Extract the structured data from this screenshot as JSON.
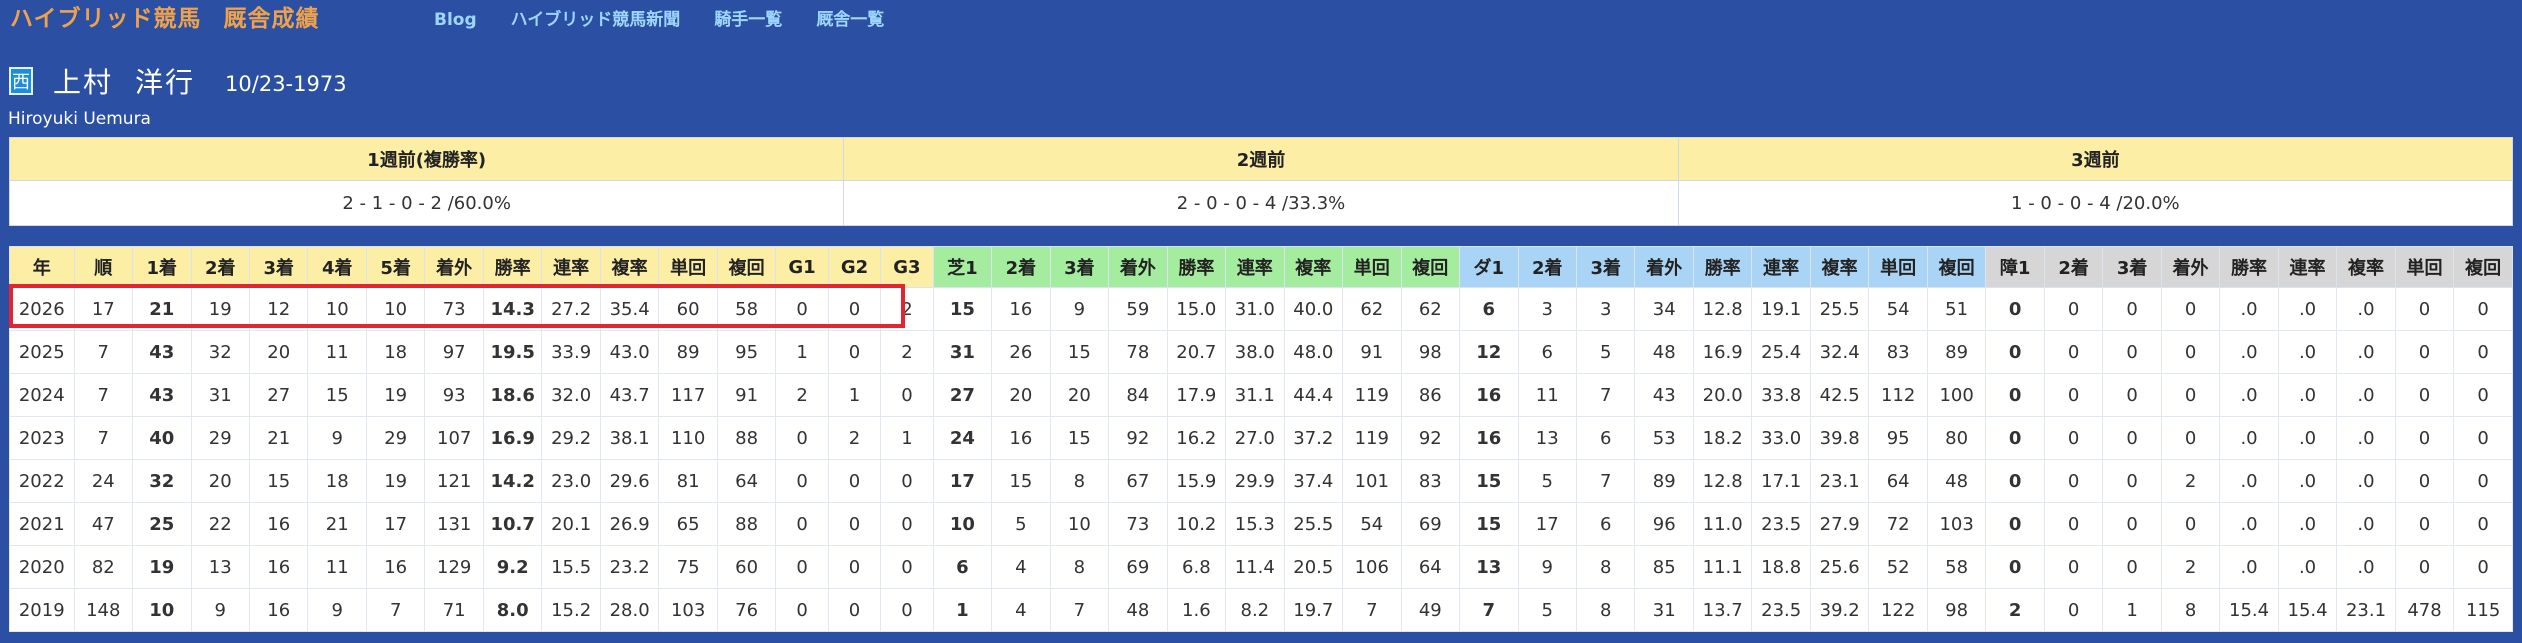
{
  "header": {
    "brand": "ハイブリッド競馬",
    "brand_sub": "厩舎成績",
    "nav": [
      "Blog",
      "ハイブリッド競馬新聞",
      "騎手一覧",
      "厩舎一覧"
    ]
  },
  "jockey": {
    "region": "西",
    "surname": "上村",
    "given_name": "洋行",
    "birthdate": "10/23-1973",
    "roman_name": "Hiroyuki Uemura"
  },
  "recent": {
    "headers": [
      "1週前(複勝率)",
      "2週前",
      "3週前"
    ],
    "values": [
      "2 - 1 - 0 - 2 /60.0%",
      "2 - 0 - 0 - 4 /33.3%",
      "1 - 0 - 0 - 4 /20.0%"
    ]
  },
  "stats": {
    "colors": {
      "overall": "#fcefa5",
      "turf": "#a5ed9e",
      "dirt": "#a9d4f6",
      "jump": "#d6d6d6",
      "highlight": "#e22530"
    },
    "headers": [
      {
        "label": "年",
        "group": "overall"
      },
      {
        "label": "順",
        "group": "overall"
      },
      {
        "label": "1着",
        "group": "overall"
      },
      {
        "label": "2着",
        "group": "overall"
      },
      {
        "label": "3着",
        "group": "overall"
      },
      {
        "label": "4着",
        "group": "overall"
      },
      {
        "label": "5着",
        "group": "overall"
      },
      {
        "label": "着外",
        "group": "overall"
      },
      {
        "label": "勝率",
        "group": "overall"
      },
      {
        "label": "連率",
        "group": "overall"
      },
      {
        "label": "複率",
        "group": "overall"
      },
      {
        "label": "単回",
        "group": "overall"
      },
      {
        "label": "複回",
        "group": "overall"
      },
      {
        "label": "G1",
        "group": "overall"
      },
      {
        "label": "G2",
        "group": "overall"
      },
      {
        "label": "G3",
        "group": "overall"
      },
      {
        "label": "芝1",
        "group": "turf"
      },
      {
        "label": "2着",
        "group": "turf"
      },
      {
        "label": "3着",
        "group": "turf"
      },
      {
        "label": "着外",
        "group": "turf"
      },
      {
        "label": "勝率",
        "group": "turf"
      },
      {
        "label": "連率",
        "group": "turf"
      },
      {
        "label": "複率",
        "group": "turf"
      },
      {
        "label": "単回",
        "group": "turf"
      },
      {
        "label": "複回",
        "group": "turf"
      },
      {
        "label": "ダ1",
        "group": "dirt"
      },
      {
        "label": "2着",
        "group": "dirt"
      },
      {
        "label": "3着",
        "group": "dirt"
      },
      {
        "label": "着外",
        "group": "dirt"
      },
      {
        "label": "勝率",
        "group": "dirt"
      },
      {
        "label": "連率",
        "group": "dirt"
      },
      {
        "label": "複率",
        "group": "dirt"
      },
      {
        "label": "単回",
        "group": "dirt"
      },
      {
        "label": "複回",
        "group": "dirt"
      },
      {
        "label": "障1",
        "group": "jump"
      },
      {
        "label": "2着",
        "group": "jump"
      },
      {
        "label": "3着",
        "group": "jump"
      },
      {
        "label": "着外",
        "group": "jump"
      },
      {
        "label": "勝率",
        "group": "jump"
      },
      {
        "label": "連率",
        "group": "jump"
      },
      {
        "label": "複率",
        "group": "jump"
      },
      {
        "label": "単回",
        "group": "jump"
      },
      {
        "label": "複回",
        "group": "jump"
      }
    ],
    "bold_columns": [
      2,
      8,
      16,
      25,
      34
    ],
    "highlighted_row": 0,
    "rows": [
      [
        "2026",
        "17",
        "21",
        "19",
        "12",
        "10",
        "10",
        "73",
        "14.3",
        "27.2",
        "35.4",
        "60",
        "58",
        "0",
        "0",
        "2",
        "15",
        "16",
        "9",
        "59",
        "15.0",
        "31.0",
        "40.0",
        "62",
        "62",
        "6",
        "3",
        "3",
        "34",
        "12.8",
        "19.1",
        "25.5",
        "54",
        "51",
        "0",
        "0",
        "0",
        "0",
        ".0",
        ".0",
        ".0",
        "0",
        "0"
      ],
      [
        "2025",
        "7",
        "43",
        "32",
        "20",
        "11",
        "18",
        "97",
        "19.5",
        "33.9",
        "43.0",
        "89",
        "95",
        "1",
        "0",
        "2",
        "31",
        "26",
        "15",
        "78",
        "20.7",
        "38.0",
        "48.0",
        "91",
        "98",
        "12",
        "6",
        "5",
        "48",
        "16.9",
        "25.4",
        "32.4",
        "83",
        "89",
        "0",
        "0",
        "0",
        "0",
        ".0",
        ".0",
        ".0",
        "0",
        "0"
      ],
      [
        "2024",
        "7",
        "43",
        "31",
        "27",
        "15",
        "19",
        "93",
        "18.6",
        "32.0",
        "43.7",
        "117",
        "91",
        "2",
        "1",
        "0",
        "27",
        "20",
        "20",
        "84",
        "17.9",
        "31.1",
        "44.4",
        "119",
        "86",
        "16",
        "11",
        "7",
        "43",
        "20.0",
        "33.8",
        "42.5",
        "112",
        "100",
        "0",
        "0",
        "0",
        "0",
        ".0",
        ".0",
        ".0",
        "0",
        "0"
      ],
      [
        "2023",
        "7",
        "40",
        "29",
        "21",
        "9",
        "29",
        "107",
        "16.9",
        "29.2",
        "38.1",
        "110",
        "88",
        "0",
        "2",
        "1",
        "24",
        "16",
        "15",
        "92",
        "16.2",
        "27.0",
        "37.2",
        "119",
        "92",
        "16",
        "13",
        "6",
        "53",
        "18.2",
        "33.0",
        "39.8",
        "95",
        "80",
        "0",
        "0",
        "0",
        "0",
        ".0",
        ".0",
        ".0",
        "0",
        "0"
      ],
      [
        "2022",
        "24",
        "32",
        "20",
        "15",
        "18",
        "19",
        "121",
        "14.2",
        "23.0",
        "29.6",
        "81",
        "64",
        "0",
        "0",
        "0",
        "17",
        "15",
        "8",
        "67",
        "15.9",
        "29.9",
        "37.4",
        "101",
        "83",
        "15",
        "5",
        "7",
        "89",
        "12.8",
        "17.1",
        "23.1",
        "64",
        "48",
        "0",
        "0",
        "0",
        "2",
        ".0",
        ".0",
        ".0",
        "0",
        "0"
      ],
      [
        "2021",
        "47",
        "25",
        "22",
        "16",
        "21",
        "17",
        "131",
        "10.7",
        "20.1",
        "26.9",
        "65",
        "88",
        "0",
        "0",
        "0",
        "10",
        "5",
        "10",
        "73",
        "10.2",
        "15.3",
        "25.5",
        "54",
        "69",
        "15",
        "17",
        "6",
        "96",
        "11.0",
        "23.5",
        "27.9",
        "72",
        "103",
        "0",
        "0",
        "0",
        "0",
        ".0",
        ".0",
        ".0",
        "0",
        "0"
      ],
      [
        "2020",
        "82",
        "19",
        "13",
        "16",
        "11",
        "16",
        "129",
        "9.2",
        "15.5",
        "23.2",
        "75",
        "60",
        "0",
        "0",
        "0",
        "6",
        "4",
        "8",
        "69",
        "6.8",
        "11.4",
        "20.5",
        "106",
        "64",
        "13",
        "9",
        "8",
        "85",
        "11.1",
        "18.8",
        "25.6",
        "52",
        "58",
        "0",
        "0",
        "0",
        "2",
        ".0",
        ".0",
        ".0",
        "0",
        "0"
      ],
      [
        "2019",
        "148",
        "10",
        "9",
        "16",
        "9",
        "7",
        "71",
        "8.0",
        "15.2",
        "28.0",
        "103",
        "76",
        "0",
        "0",
        "0",
        "1",
        "4",
        "7",
        "48",
        "1.6",
        "8.2",
        "19.7",
        "7",
        "49",
        "7",
        "5",
        "8",
        "31",
        "13.7",
        "23.5",
        "39.2",
        "122",
        "98",
        "2",
        "0",
        "1",
        "8",
        "15.4",
        "15.4",
        "23.1",
        "478",
        "115"
      ]
    ]
  }
}
